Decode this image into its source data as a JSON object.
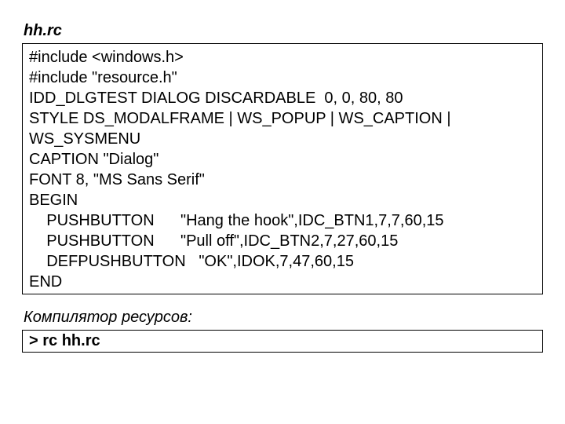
{
  "filename": "hh.rc",
  "code": "#include <windows.h>\n#include \"resource.h\"\nIDD_DLGTEST DIALOG DISCARDABLE  0, 0, 80, 80\nSTYLE DS_MODALFRAME | WS_POPUP | WS_CAPTION | WS_SYSMENU\nCAPTION \"Dialog\"\nFONT 8, \"MS Sans Serif\"\nBEGIN\n    PUSHBUTTON      \"Hang the hook\",IDC_BTN1,7,7,60,15\n    PUSHBUTTON      \"Pull off\",IDC_BTN2,7,27,60,15\n    DEFPUSHBUTTON   \"OK\",IDOK,7,47,60,15\nEND",
  "compiler_caption": "Компилятор ресурсов:",
  "command": "> rc  hh.rc"
}
